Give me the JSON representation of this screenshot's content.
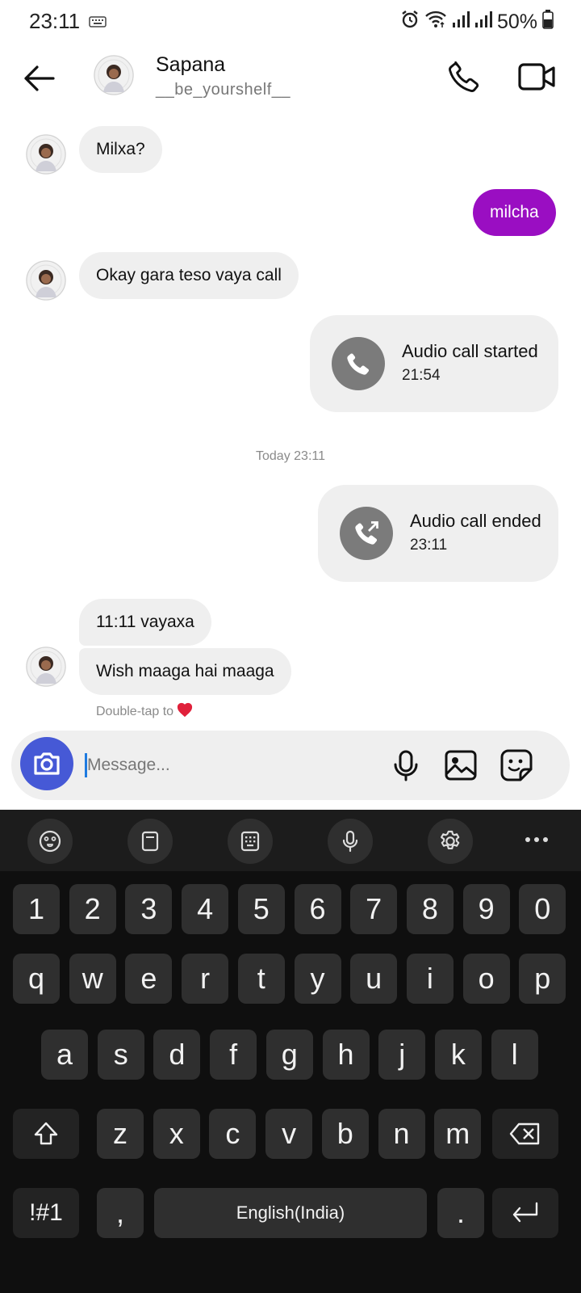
{
  "status_bar": {
    "time": "23:11",
    "battery": "50%",
    "icons": [
      "keyboard-icon",
      "alarm-icon",
      "wifi-icon",
      "signal-icon",
      "signal-icon",
      "battery-icon"
    ]
  },
  "header": {
    "name": "Sapana",
    "username": "__be_yourshelf__"
  },
  "messages": {
    "m1": "Milxa?",
    "m2": "milcha",
    "m3": "Okay gara teso vaya call",
    "call1": {
      "title": "Audio call started",
      "time": "21:54"
    },
    "divider": "Today 23:11",
    "call2": {
      "title": "Audio call ended",
      "time": "23:11"
    },
    "m4": "11:11 vayaxa",
    "m5": "Wish maaga hai maaga",
    "hint": "Double-tap to"
  },
  "composer": {
    "placeholder": "Message..."
  },
  "keyboard": {
    "row_numbers": [
      "1",
      "2",
      "3",
      "4",
      "5",
      "6",
      "7",
      "8",
      "9",
      "0"
    ],
    "row_q": [
      "q",
      "w",
      "e",
      "r",
      "t",
      "y",
      "u",
      "i",
      "o",
      "p"
    ],
    "row_a": [
      "a",
      "s",
      "d",
      "f",
      "g",
      "h",
      "j",
      "k",
      "l"
    ],
    "row_z": [
      "z",
      "x",
      "c",
      "v",
      "b",
      "n",
      "m"
    ],
    "symbols_label": "!#1",
    "comma": ",",
    "space_label": "English(India)",
    "period": "."
  },
  "colors": {
    "outgoing_bubble": "#9a0ec2",
    "camera_button": "#4659d6",
    "keyboard_bg": "#0f0f0f",
    "heart": "#e0203a"
  }
}
